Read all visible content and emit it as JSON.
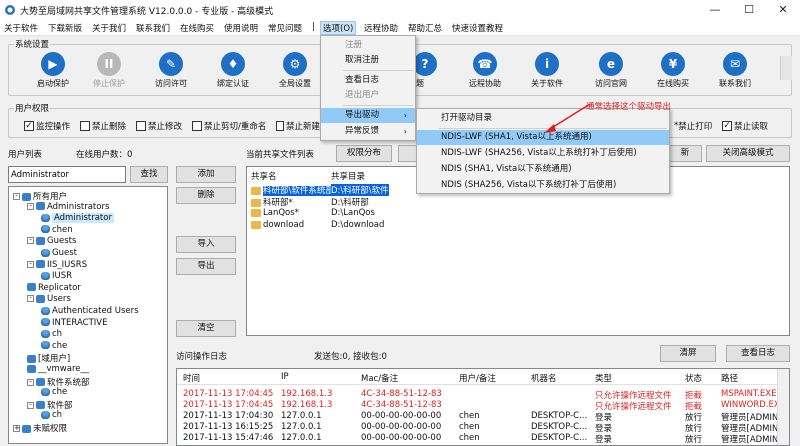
{
  "title": "大势至局域网共享文件管理系统 V12.0.0.0 - 专业版 - 高级模式",
  "window_controls": {
    "minimize": "—",
    "maximize": "☐",
    "close": "✕"
  },
  "menu": [
    "关于软件",
    "下载新版",
    "关于我们",
    "联系我们",
    "在线购买",
    "使用说明",
    "常见问题",
    "|",
    "选项(O)",
    "远程协助",
    "帮助汇总",
    "快速设置教程"
  ],
  "system_settings": {
    "label": "系统设置",
    "buttons": [
      "启动保护",
      "停止保护",
      "访问许可",
      "绑定认证",
      "全局设置",
      "问题",
      "远程协助",
      "关于软件",
      "访问官网",
      "在线购买",
      "联系我们"
    ]
  },
  "user_permissions": {
    "label": "用户权限",
    "checkboxes": [
      {
        "label": "监控操作",
        "checked": true
      },
      {
        "label": "禁止删除",
        "checked": false
      },
      {
        "label": "禁止修改",
        "checked": false
      },
      {
        "label": "禁止剪切/重命名",
        "checked": false
      },
      {
        "label": "禁止新建",
        "checked": false
      },
      {
        "label": "禁止打印",
        "checked": false,
        "prefix": "*"
      },
      {
        "label": "禁止读取",
        "checked": true
      }
    ]
  },
  "user_list": {
    "label": "用户列表",
    "online_label": "在线用户数：0",
    "search_value": "Administrator",
    "search_button": "查找",
    "tree": [
      {
        "text": "所有用户",
        "level": 0,
        "exp": "-",
        "icon": "group"
      },
      {
        "text": "Administrators",
        "level": 1,
        "exp": "-",
        "icon": "group"
      },
      {
        "text": "Administrator",
        "level": 2,
        "icon": "user",
        "selected": true
      },
      {
        "text": "chen",
        "level": 2,
        "icon": "user"
      },
      {
        "text": "Guests",
        "level": 1,
        "exp": "-",
        "icon": "group"
      },
      {
        "text": "Guest",
        "level": 2,
        "icon": "user"
      },
      {
        "text": "IIS_IUSRS",
        "level": 1,
        "exp": "-",
        "icon": "group"
      },
      {
        "text": "IUSR",
        "level": 2,
        "icon": "user"
      },
      {
        "text": "Replicator",
        "level": 1,
        "icon": "group"
      },
      {
        "text": "Users",
        "level": 1,
        "exp": "-",
        "icon": "group"
      },
      {
        "text": "Authenticated Users",
        "level": 2,
        "icon": "user"
      },
      {
        "text": "INTERACTIVE",
        "level": 2,
        "icon": "user"
      },
      {
        "text": "ch",
        "level": 2,
        "icon": "user"
      },
      {
        "text": "che",
        "level": 2,
        "icon": "user"
      },
      {
        "text": "[域用户]",
        "level": 1,
        "icon": "group"
      },
      {
        "text": "__vmware__",
        "level": 1,
        "icon": "group"
      },
      {
        "text": "软件系统部",
        "level": 1,
        "exp": "-",
        "icon": "group"
      },
      {
        "text": "che",
        "level": 2,
        "icon": "user"
      },
      {
        "text": "软件部",
        "level": 1,
        "exp": "-",
        "icon": "group"
      },
      {
        "text": "ch",
        "level": 2,
        "icon": "user"
      },
      {
        "text": "未赋权限",
        "level": 0,
        "exp": "+",
        "icon": "group"
      }
    ]
  },
  "actions": {
    "add": "添加",
    "delete": "删除",
    "import": "导入",
    "export": "导出",
    "clear": "清空"
  },
  "share_list": {
    "label": "当前共享文件列表",
    "perm_button": "权限分布",
    "right_buttons": [
      "新",
      "关闭高级模式"
    ],
    "columns": [
      "共享名",
      "共享目录"
    ],
    "rows": [
      {
        "name": "科研部\\软件系统部*",
        "dir": "D:\\科研部\\软件",
        "selected": true
      },
      {
        "name": "科研部*",
        "dir": "D:\\科研部"
      },
      {
        "name": "LanQos*",
        "dir": "D:\\LanQos"
      },
      {
        "name": "download",
        "dir": "D:\\download"
      }
    ]
  },
  "log": {
    "label": "访问操作日志",
    "packets": "发送包:0, 接收包:0",
    "clear_button": "清屏",
    "view_button": "查看日志",
    "columns": [
      "时间",
      "IP",
      "Mac/备注",
      "用户/备注",
      "机器名",
      "类型",
      "状态",
      "路径"
    ],
    "rows": [
      {
        "time": "2017-11-13 17:04:45",
        "ip": "192.168.1.3",
        "mac": "4C-34-88-51-12-83",
        "user": "",
        "machine": "",
        "type": "只允许操作远程文件",
        "status": "拒截",
        "path": "MSPAINT.EXE",
        "red": true
      },
      {
        "time": "2017-11-13 17:04:45",
        "ip": "192.168.1.3",
        "mac": "4C-34-88-51-12-83",
        "user": "",
        "machine": "",
        "type": "只允许操作远程文件",
        "status": "拒截",
        "path": "WINWORD.EXE",
        "red": true
      },
      {
        "time": "2017-11-13 17:04:30",
        "ip": "127.0.0.1",
        "mac": "00-00-00-00-00-00",
        "user": "chen",
        "machine": "DESKTOP-C...",
        "type": "登录",
        "status": "放行",
        "path": "管理员[ADMIN",
        "red": false
      },
      {
        "time": "2017-11-13 16:15:25",
        "ip": "127.0.0.1",
        "mac": "00-00-00-00-00-00",
        "user": "chen",
        "machine": "DESKTOP-C...",
        "type": "登录",
        "status": "放行",
        "path": "管理员[ADMIN",
        "red": false
      },
      {
        "time": "2017-11-13 15:47:46",
        "ip": "127.0.0.1",
        "mac": "00-00-00-00-00-00",
        "user": "chen",
        "machine": "DESKTOP-C...",
        "type": "登录",
        "status": "放行",
        "path": "管理员[ADMIN",
        "red": false
      }
    ]
  },
  "options_menu": {
    "items": [
      {
        "label": "注册",
        "disabled": true
      },
      {
        "label": "取消注册",
        "disabled": false
      },
      {
        "label": "查看日志",
        "disabled": false
      },
      {
        "label": "退出用户",
        "disabled": true
      },
      {
        "label": "导出驱动",
        "submenu": true,
        "highlight": true
      },
      {
        "label": "异常反馈",
        "submenu": true
      }
    ]
  },
  "submenu": {
    "items": [
      {
        "label": "打开驱动目录"
      },
      {
        "label": "NDIS-LWF (SHA1, Vista以上系统通用)",
        "selected": true
      },
      {
        "label": "NDIS-LWF (SHA256, Vista以上系统打补丁后使用)"
      },
      {
        "label": "NDIS (SHA1, Vista以下系统通用)"
      },
      {
        "label": "NDIS (SHA256, Vista以下系统打补丁后使用)"
      }
    ]
  },
  "annotation": "通常选择这个驱动导出",
  "colors": {
    "accent": "#1f6fc5",
    "red": "#e02020",
    "selection": "#91c9f7"
  }
}
